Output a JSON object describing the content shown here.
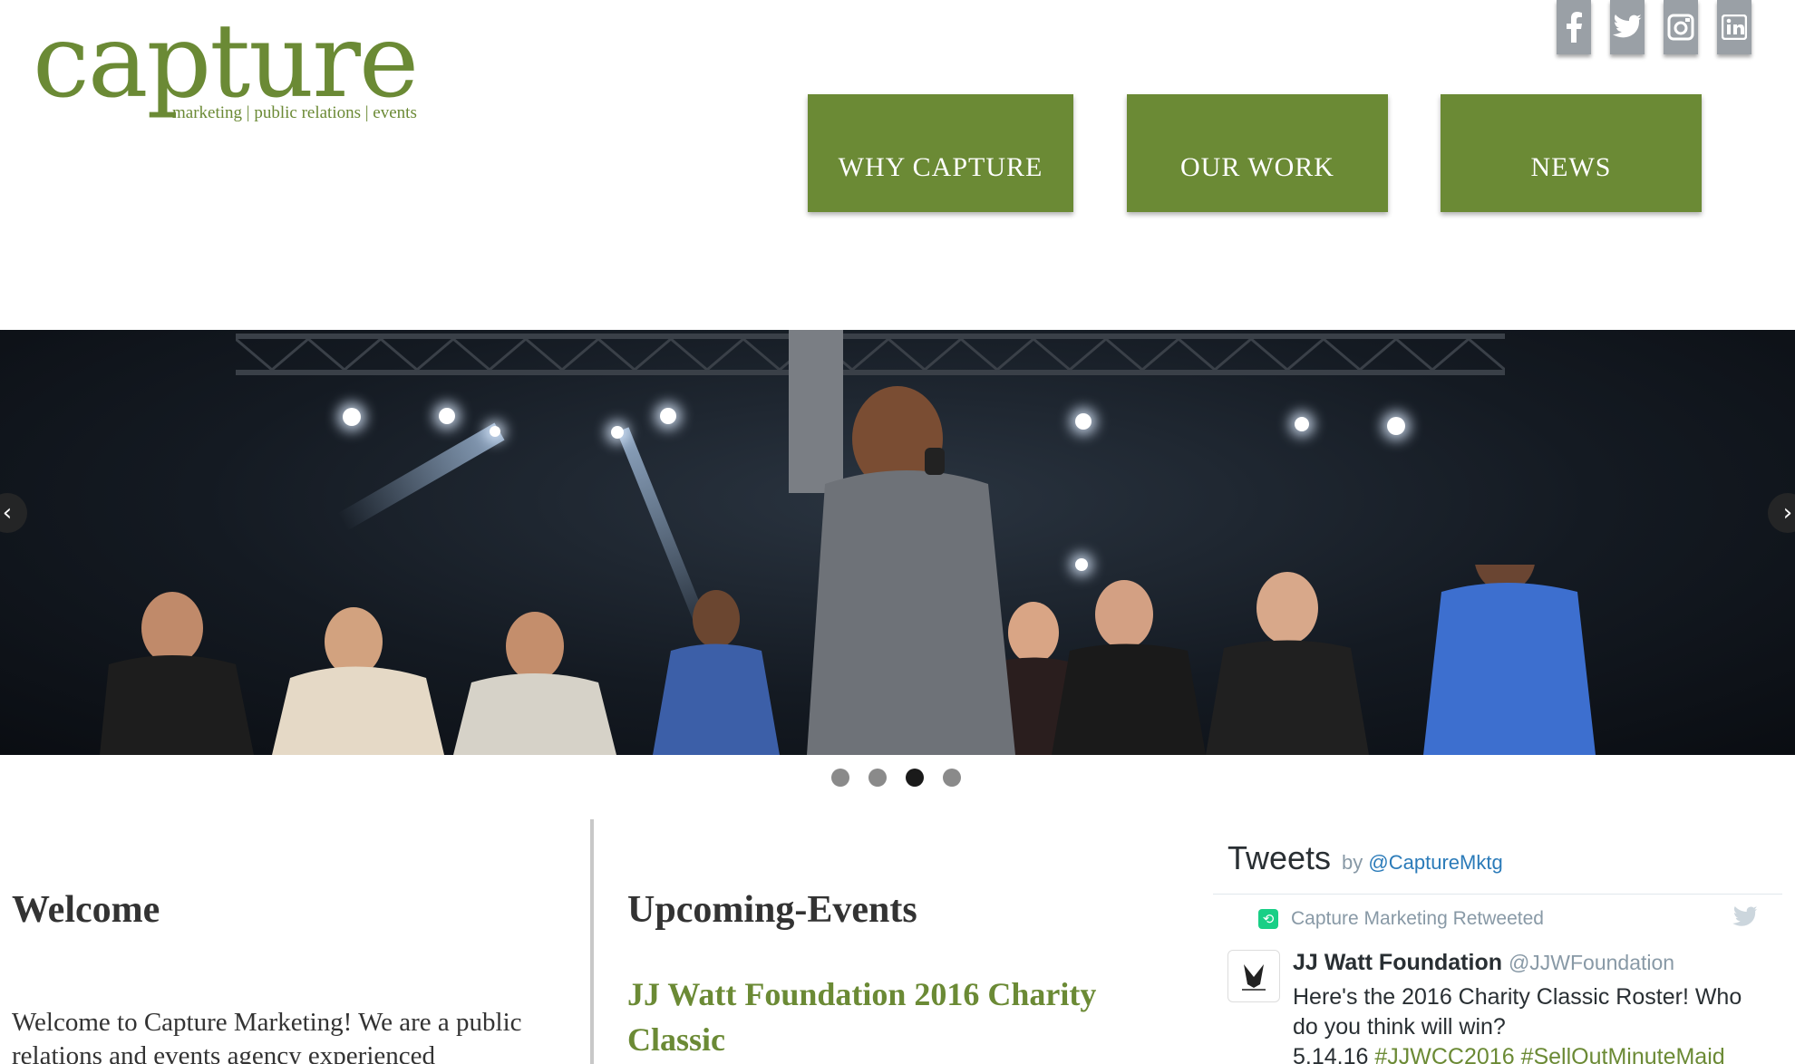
{
  "header": {
    "logo_word": "capture",
    "logo_tagline": "marketing | public relations | events",
    "social": [
      "facebook-icon",
      "twitter-icon",
      "instagram-icon",
      "linkedin-icon"
    ],
    "nav": [
      {
        "label": "WHY CAPTURE"
      },
      {
        "label": "OUR WORK"
      },
      {
        "label": "NEWS"
      }
    ]
  },
  "slider": {
    "prev_glyph": "‹",
    "next_glyph": "›",
    "slide_count": 4,
    "active_slide": 3
  },
  "welcome": {
    "heading": "Welcome",
    "text": "Welcome to Capture Marketing! We are a public relations and events agency experienced"
  },
  "events": {
    "heading": "Upcoming-Events",
    "first_event": "JJ Watt Foundation 2016 Charity Classic"
  },
  "tweets": {
    "title": "Tweets",
    "by": "by",
    "handle": "@CaptureMktg",
    "retweet_label": "Capture Marketing Retweeted",
    "author_name": "JJ Watt Foundation",
    "author_handle": "@JJWFoundation",
    "text": "Here's the 2016 Charity Classic Roster! Who do you think will win?",
    "date": "5.14.16",
    "hashtag1": "#JJWCC2016",
    "hashtag2": "#SellOutMinuteMaid"
  },
  "colors": {
    "brand_green": "#6b8a35",
    "twitter_blue": "#2b7bb9",
    "social_gray": "#9aa0a6"
  }
}
